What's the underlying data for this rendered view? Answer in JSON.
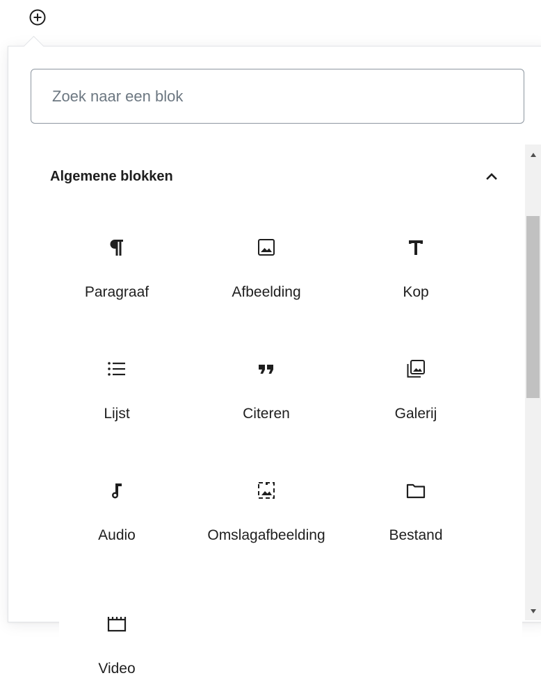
{
  "search": {
    "placeholder": "Zoek naar een blok",
    "value": ""
  },
  "panel": {
    "title": "Algemene blokken"
  },
  "blocks": [
    {
      "label": "Paragraaf",
      "icon": "paragraph-icon"
    },
    {
      "label": "Afbeelding",
      "icon": "image-icon"
    },
    {
      "label": "Kop",
      "icon": "heading-icon"
    },
    {
      "label": "Lijst",
      "icon": "list-icon"
    },
    {
      "label": "Citeren",
      "icon": "quote-icon"
    },
    {
      "label": "Galerij",
      "icon": "gallery-icon"
    },
    {
      "label": "Audio",
      "icon": "audio-icon"
    },
    {
      "label": "Omslagafbeelding",
      "icon": "cover-icon"
    },
    {
      "label": "Bestand",
      "icon": "file-icon"
    },
    {
      "label": "Video",
      "icon": "video-icon"
    }
  ],
  "colors": {
    "text": "#1e1e1e",
    "border": "#8d96a0",
    "placeholder": "#6c7781",
    "scroll_thumb": "#c1c1c1"
  }
}
